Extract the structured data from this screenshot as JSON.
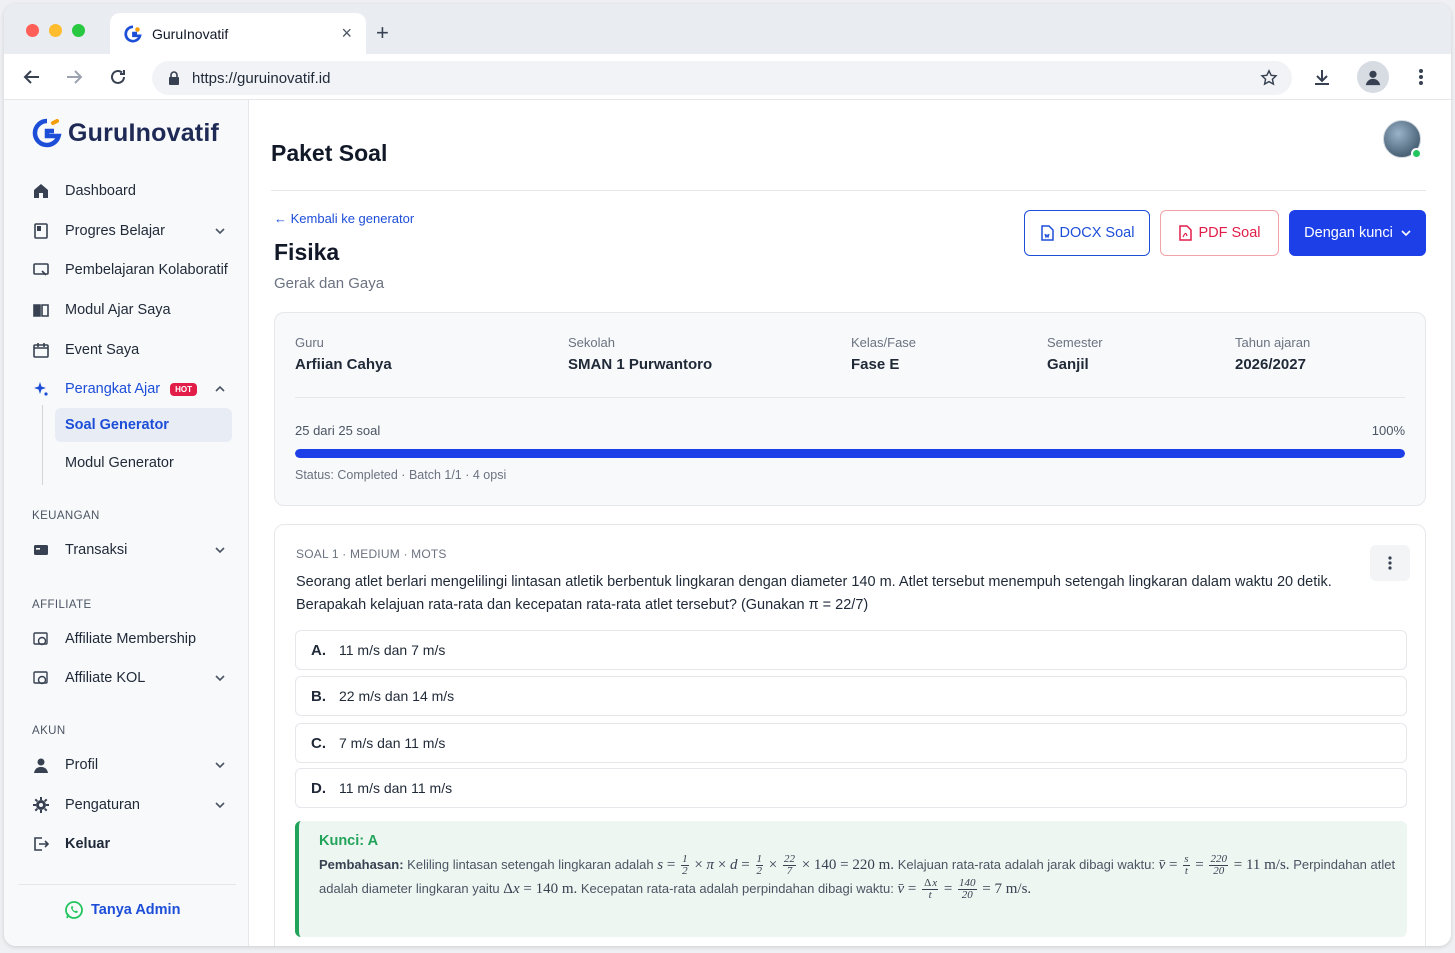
{
  "browser": {
    "tab_title": "GuruInovatif",
    "url": "https://guruinovatif.id"
  },
  "sidebar": {
    "brand": "GuruInovatif",
    "nav": [
      {
        "label": "Dashboard"
      },
      {
        "label": "Progres Belajar"
      },
      {
        "label": "Pembelajaran Kolaboratif"
      },
      {
        "label": "Modul Ajar Saya"
      },
      {
        "label": "Event Saya"
      },
      {
        "label": "Perangkat Ajar",
        "badge": "HOT"
      }
    ],
    "subnav": [
      {
        "label": "Soal Generator"
      },
      {
        "label": "Modul Generator"
      }
    ],
    "sections": {
      "keuangan": "KEUANGAN",
      "affiliate": "AFFILIATE",
      "akun": "AKUN"
    },
    "keuangan_items": [
      {
        "label": "Transaksi"
      }
    ],
    "affiliate_items": [
      {
        "label": "Affiliate Membership"
      },
      {
        "label": "Affiliate KOL"
      }
    ],
    "akun_items": [
      {
        "label": "Profil"
      },
      {
        "label": "Pengaturan"
      },
      {
        "label": "Keluar"
      }
    ],
    "tanya_admin": "Tanya Admin"
  },
  "page": {
    "title": "Paket Soal",
    "back_link": "← Kembali ke generator",
    "subject": "Fisika",
    "topic": "Gerak dan Gaya",
    "buttons": {
      "docx": "DOCX Soal",
      "pdf": "PDF Soal",
      "kunci": "Dengan kunci"
    },
    "info": [
      {
        "label": "Guru",
        "value": "Arfiian Cahya"
      },
      {
        "label": "Sekolah",
        "value": "SMAN 1 Purwantoro"
      },
      {
        "label": "Kelas/Fase",
        "value": "Fase E"
      },
      {
        "label": "Semester",
        "value": "Ganjil"
      },
      {
        "label": "Tahun ajaran",
        "value": "2026/2027"
      }
    ],
    "progress": {
      "count_text": "25 dari 25 soal",
      "percent_text": "100%",
      "fraction": 1.0,
      "status_text": "Status: Completed · Batch 1/1 · 4 opsi"
    }
  },
  "question": {
    "meta": "SOAL 1 · MEDIUM · MOTS",
    "text": "Seorang atlet berlari mengelilingi lintasan atletik berbentuk lingkaran dengan diameter 140 m. Atlet tersebut menempuh setengah lingkaran dalam waktu 20 detik. Berapakah kelajuan rata-rata dan kecepatan rata-rata atlet tersebut? (Gunakan π = 22/7)",
    "options": [
      {
        "label": "A.",
        "text": "11 m/s dan 7 m/s"
      },
      {
        "label": "B.",
        "text": "22 m/s dan 14 m/s"
      },
      {
        "label": "C.",
        "text": "7 m/s dan 11 m/s"
      },
      {
        "label": "D.",
        "text": "11 m/s dan 11 m/s"
      }
    ],
    "answer_key": "Kunci: A",
    "explanation_label": "Pembahasan:",
    "explanation_1": "Keliling lintasan setengah lingkaran adalah",
    "explanation_2": "Kelajuan rata-rata adalah jarak dibagi waktu:",
    "explanation_3": "Perpindahan atlet adalah diameter lingkaran yaitu",
    "explanation_4": "Kecepatan rata-rata adalah perpindahan dibagi waktu:"
  },
  "colors": {
    "primary": "#1d3fe8",
    "link": "#1d4ed8",
    "pdf": "#e11d48",
    "success": "#22a35a"
  }
}
